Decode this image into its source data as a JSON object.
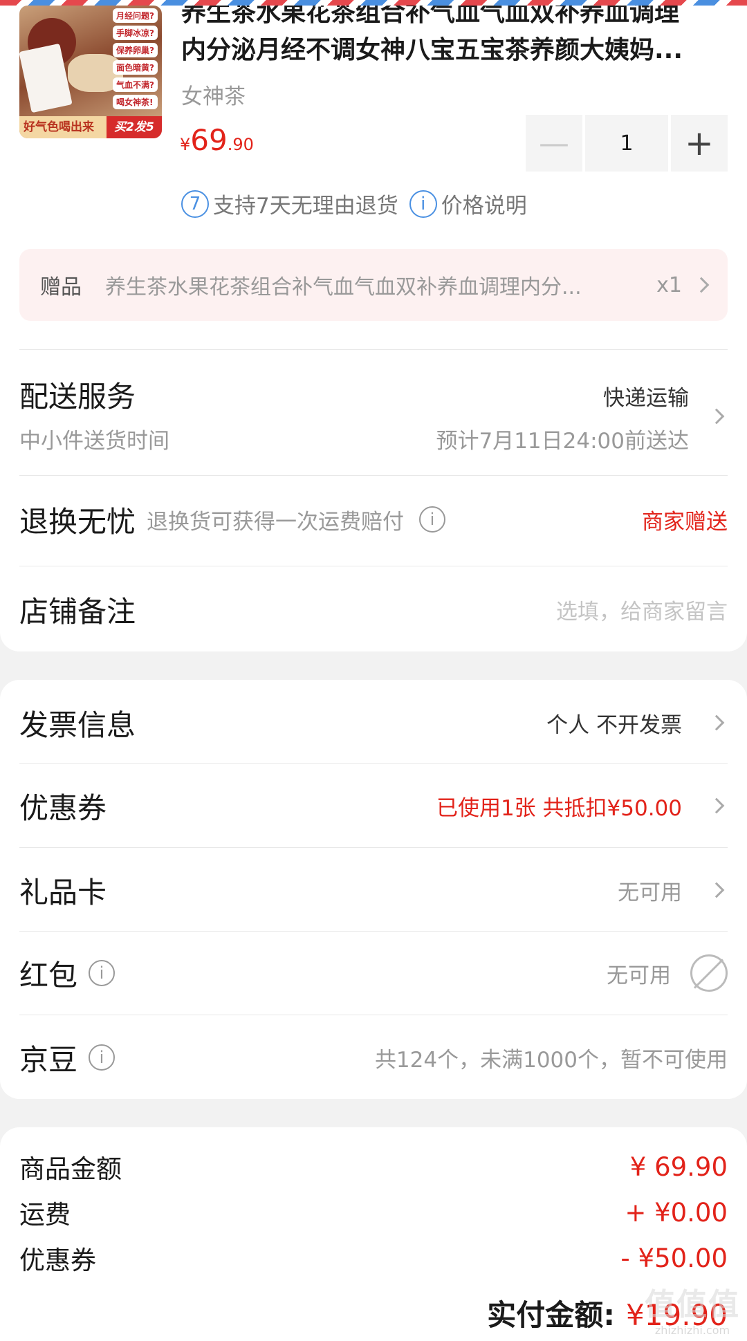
{
  "product": {
    "title_line1": "养生茶水果花茶组合补气血气血双补养血调理",
    "title_line2": "内分泌月经不调女神八宝五宝茶养颜大姨妈...",
    "shop": "女神茶",
    "price_currency": "¥",
    "price_int": "69",
    "price_dec": ".90",
    "quantity": "1",
    "minus_label": "—",
    "plus_label": "+",
    "return_icon_text": "7",
    "return_policy": "支持7天无理由退货",
    "info_icon_text": "i",
    "price_note": "价格说明",
    "thumb": {
      "tags": [
        "月经问题?",
        "手脚冰凉?",
        "保养卵巢?",
        "面色暗黄?",
        "气血不满?",
        "喝女神茶!"
      ],
      "banner_left": "好气色喝出来",
      "banner_right": "买2发5"
    }
  },
  "gift": {
    "label": "赠品",
    "name": "养生茶水果花茶组合补气血气血双补养血调理内分...",
    "count": "x1"
  },
  "delivery": {
    "label": "配送服务",
    "sub": "中小件送货时间",
    "method": "快递运输",
    "eta": "预计7月11日24:00前送达"
  },
  "returns": {
    "label": "退换无忧",
    "desc": "退换货可获得一次运费赔付",
    "value": "商家赠送"
  },
  "remark": {
    "label": "店铺备注",
    "placeholder": "选填，给商家留言"
  },
  "invoice": {
    "label": "发票信息",
    "value": "个人 不开发票"
  },
  "coupon": {
    "label": "优惠券",
    "value": "已使用1张 共抵扣¥50.00"
  },
  "giftcard": {
    "label": "礼品卡",
    "value": "无可用"
  },
  "redpacket": {
    "label": "红包",
    "value": "无可用"
  },
  "jdbean": {
    "label": "京豆",
    "value": "共124个，未满1000个，暂不可使用"
  },
  "summary": {
    "goods_label": "商品金额",
    "goods_value": "¥ 69.90",
    "shipping_label": "运费",
    "shipping_value": "+ ¥0.00",
    "coupon_label": "优惠券",
    "coupon_value": "- ¥50.00",
    "total_label": "实付金额:",
    "total_value": "¥19.90"
  },
  "watermark": {
    "big": "值值值",
    "small": "zhizhizhi.com"
  },
  "colors": {
    "accent_red": "#e2231a",
    "info_blue": "#4a90e2",
    "gift_bg": "#fdf1f1"
  }
}
